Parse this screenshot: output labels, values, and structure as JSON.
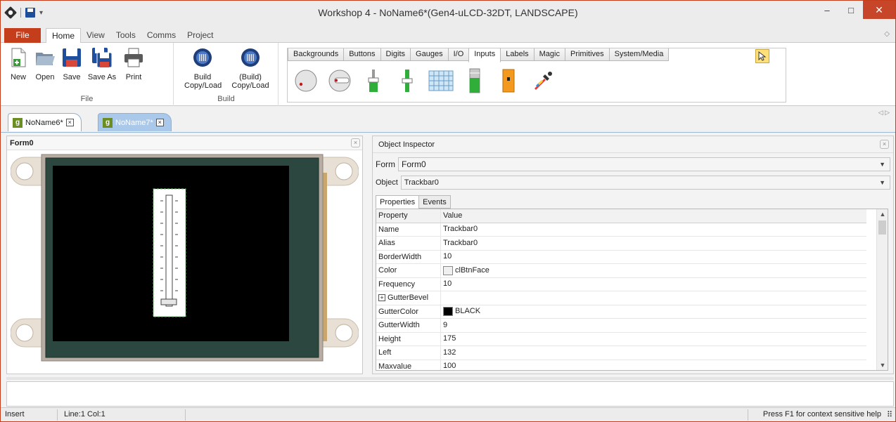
{
  "window": {
    "title": "Workshop 4 - NoName6*(Gen4-uLCD-32DT, LANDSCAPE)",
    "minimize_glyph": "–",
    "maximize_glyph": "□",
    "close_glyph": "✕"
  },
  "menu": {
    "file": "File",
    "tabs": [
      "Home",
      "View",
      "Tools",
      "Comms",
      "Project"
    ],
    "active_tab": "Home"
  },
  "ribbon": {
    "file_group": {
      "label": "File",
      "buttons": [
        "New",
        "Open",
        "Save",
        "Save As",
        "Print"
      ]
    },
    "build_group": {
      "label": "Build",
      "build_line1": "Build",
      "build_line2": "Copy/Load",
      "build2_line1": "(Build)",
      "build2_line2": "Copy/Load"
    },
    "palette_tabs": [
      "Backgrounds",
      "Buttons",
      "Digits",
      "Gauges",
      "I/O",
      "Inputs",
      "Labels",
      "Magic",
      "Primitives",
      "System/Media"
    ],
    "active_palette_tab": "Inputs",
    "palette_icons": [
      "knob-icon",
      "rotary-switch-icon",
      "slider-icon",
      "trackbar-icon",
      "keyboard-icon",
      "meter-bar-icon",
      "switch-icon",
      "color-picker-icon"
    ]
  },
  "doc_tabs": [
    {
      "label": "NoName6*",
      "active": true
    },
    {
      "label": "NoName7*",
      "active": false
    }
  ],
  "form_panel": {
    "title": "Form0",
    "trackbar_value_fraction": 0.0
  },
  "inspector": {
    "title": "Object Inspector",
    "form_label": "Form",
    "form_value": "Form0",
    "object_label": "Object",
    "object_value": "Trackbar0",
    "tabs": [
      "Properties",
      "Events"
    ],
    "columns": [
      "Property",
      "Value"
    ],
    "rows": [
      {
        "property": "Name",
        "value": "Trackbar0"
      },
      {
        "property": "Alias",
        "value": "Trackbar0"
      },
      {
        "property": "BorderWidth",
        "value": "10"
      },
      {
        "property": "Color",
        "value": "clBtnFace",
        "swatch": "#f0f0f0"
      },
      {
        "property": "Frequency",
        "value": "10"
      },
      {
        "property": "GutterBevel",
        "value": "",
        "expandable": true
      },
      {
        "property": "GutterColor",
        "value": "BLACK",
        "swatch": "#000000"
      },
      {
        "property": "GutterWidth",
        "value": "9"
      },
      {
        "property": "Height",
        "value": "175"
      },
      {
        "property": "Left",
        "value": "132"
      },
      {
        "property": "Maxvalue",
        "value": "100"
      }
    ]
  },
  "status": {
    "mode": "Insert",
    "position": "Line:1 Col:1",
    "help": "Press F1 for context sensitive help"
  },
  "colors": {
    "accent": "#c43e1c",
    "tab_blue": "#a9c8ea",
    "grip_green": "#59c659"
  }
}
